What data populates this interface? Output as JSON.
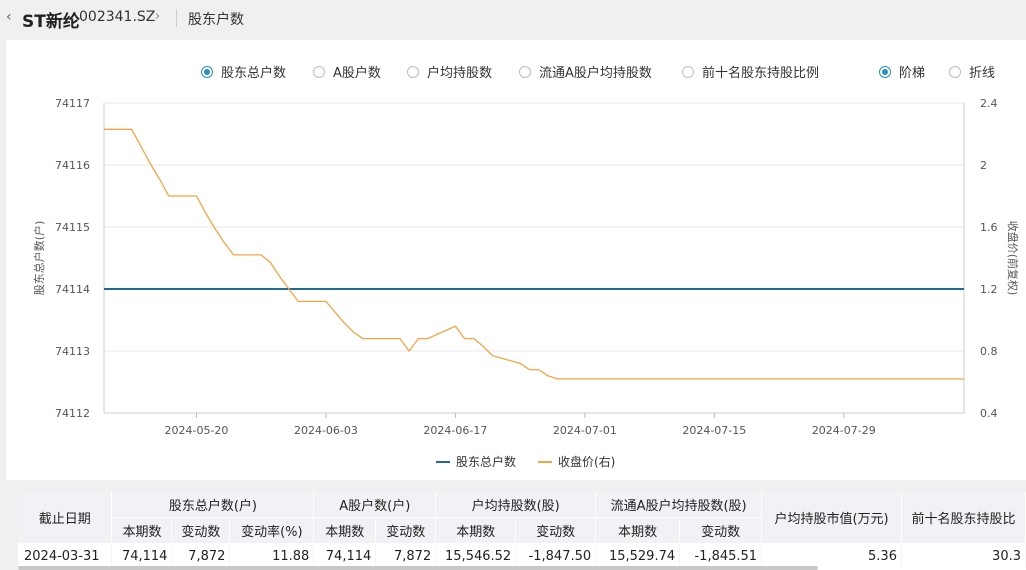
{
  "header": {
    "back_icon": "‹",
    "stock_name": "ST新纶",
    "stock_code": "002341.SZ",
    "forward_icon": "›",
    "page_title": "股东户数"
  },
  "options": [
    {
      "label": "股东总户数",
      "selected": true
    },
    {
      "label": "A股户数",
      "selected": false
    },
    {
      "label": "户均持股数",
      "selected": false
    },
    {
      "label": "流通A股户均持股数",
      "selected": false
    },
    {
      "label": "前十名股东持股比例",
      "selected": false
    }
  ],
  "chart_mode": [
    {
      "label": "阶梯",
      "selected": true
    },
    {
      "label": "折线",
      "selected": false
    }
  ],
  "chart_data": {
    "type": "line",
    "x_ticks": [
      "2024-05-20",
      "2024-06-03",
      "2024-06-17",
      "2024-07-01",
      "2024-07-15",
      "2024-07-29"
    ],
    "x_range": [
      "2024-05-10",
      "2024-08-11"
    ],
    "y_left": {
      "label": "股东总户数(户)",
      "ticks": [
        74112,
        74113,
        74114,
        74115,
        74116,
        74117
      ],
      "range": [
        74112,
        74117
      ]
    },
    "y_right": {
      "label": "收盘价(前复权)",
      "ticks": [
        "0.4",
        "0.8",
        "1.2",
        "1.6",
        "2",
        "2.4"
      ],
      "range": [
        0.4,
        2.4
      ]
    },
    "series": [
      {
        "name": "股东总户数",
        "axis": "left",
        "color": "#1f6b96",
        "x": [
          "2024-05-10",
          "2024-08-11"
        ],
        "values": [
          74114,
          74114
        ]
      },
      {
        "name": "收盘价(右)",
        "axis": "right",
        "color": "#f5a443",
        "x": [
          "2024-05-10",
          "2024-05-13",
          "2024-05-14",
          "2024-05-15",
          "2024-05-16",
          "2024-05-17",
          "2024-05-20",
          "2024-05-21",
          "2024-05-22",
          "2024-05-23",
          "2024-05-24",
          "2024-05-27",
          "2024-05-28",
          "2024-05-29",
          "2024-05-30",
          "2024-05-31",
          "2024-06-03",
          "2024-06-04",
          "2024-06-05",
          "2024-06-06",
          "2024-06-07",
          "2024-06-11",
          "2024-06-12",
          "2024-06-13",
          "2024-06-14",
          "2024-06-17",
          "2024-06-18",
          "2024-06-19",
          "2024-06-20",
          "2024-06-21",
          "2024-06-24",
          "2024-06-25",
          "2024-06-26",
          "2024-06-27",
          "2024-06-28",
          "2024-07-01",
          "2024-08-11"
        ],
        "values": [
          2.23,
          2.23,
          2.12,
          2.01,
          1.91,
          1.8,
          1.8,
          1.69,
          1.59,
          1.5,
          1.42,
          1.42,
          1.37,
          1.28,
          1.2,
          1.12,
          1.12,
          1.05,
          0.98,
          0.92,
          0.88,
          0.88,
          0.8,
          0.88,
          0.88,
          0.96,
          0.88,
          0.88,
          0.83,
          0.77,
          0.72,
          0.68,
          0.68,
          0.64,
          0.62,
          0.62,
          0.62
        ]
      }
    ],
    "legend": [
      "股东总户数",
      "收盘价(右)"
    ],
    "legend_position": "bottom",
    "grid": true
  },
  "table": {
    "date_header": "截止日期",
    "groups": [
      "股东总户数(户)",
      "A股户数(户)",
      "户均持股数(股)",
      "流通A股户均持股数(股)",
      "户均持股市值(万元)",
      "前十名股东持股比"
    ],
    "sub_headers": [
      "本期数",
      "变动数",
      "变动率(%)",
      "本期数",
      "变动数",
      "本期数",
      "变动数",
      "本期数",
      "变动数"
    ],
    "rows": [
      [
        "2024-03-31",
        "74,114",
        "7,872",
        "11.88",
        "74,114",
        "7,872",
        "15,546.52",
        "-1,847.50",
        "15,529.74",
        "-1,845.51",
        "5.36",
        "30.3"
      ]
    ]
  }
}
